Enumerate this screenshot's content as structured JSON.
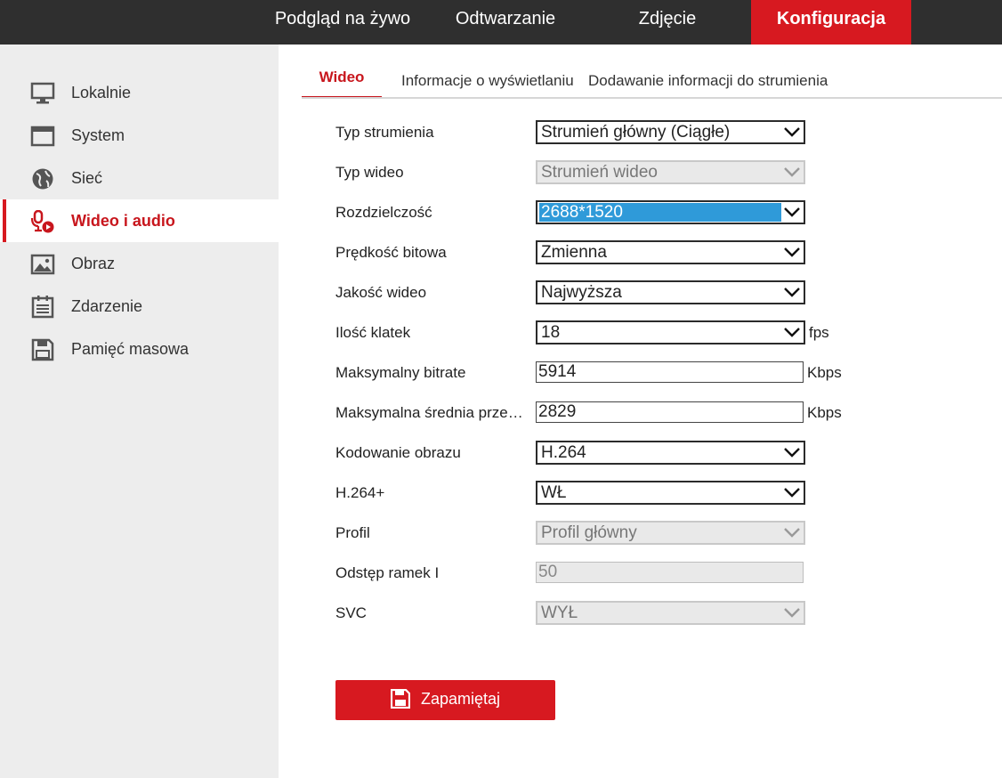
{
  "topnav": {
    "live": "Podgląd na żywo",
    "playback": "Odtwarzanie",
    "picture": "Zdjęcie",
    "config": "Konfiguracja"
  },
  "sidebar": {
    "items": [
      {
        "label": "Lokalnie",
        "icon": "monitor-icon"
      },
      {
        "label": "System",
        "icon": "window-icon"
      },
      {
        "label": "Sieć",
        "icon": "globe-icon"
      },
      {
        "label": "Wideo i audio",
        "icon": "microphone-video-icon",
        "active": true
      },
      {
        "label": "Obraz",
        "icon": "image-icon"
      },
      {
        "label": "Zdarzenie",
        "icon": "calendar-list-icon"
      },
      {
        "label": "Pamięć masowa",
        "icon": "floppy-icon"
      }
    ]
  },
  "tabs": {
    "video": "Wideo",
    "display_info": "Informacje o wyświetlaniu",
    "stream_info": "Dodawanie informacji do strumienia"
  },
  "form": {
    "stream_type": {
      "label": "Typ strumienia",
      "value": "Strumień główny (Ciągłe)"
    },
    "video_type": {
      "label": "Typ wideo",
      "value": "Strumień wideo"
    },
    "resolution": {
      "label": "Rozdzielczość",
      "value": "2688*1520"
    },
    "bitrate_type": {
      "label": "Prędkość bitowa",
      "value": "Zmienna"
    },
    "video_quality": {
      "label": "Jakość wideo",
      "value": "Najwyższa"
    },
    "frame_rate": {
      "label": "Ilość klatek",
      "value": "18",
      "unit": "fps"
    },
    "max_bitrate": {
      "label": "Maksymalny bitrate",
      "value": "5914",
      "unit": "Kbps"
    },
    "avg_bitrate": {
      "label": "Maksymalna średnia prze…",
      "value": "2829",
      "unit": "Kbps"
    },
    "encoding": {
      "label": "Kodowanie obrazu",
      "value": "H.264"
    },
    "h264plus": {
      "label": "H.264+",
      "value": "WŁ"
    },
    "profile": {
      "label": "Profil",
      "value": "Profil główny"
    },
    "i_frame": {
      "label": "Odstęp ramek I",
      "value": "50"
    },
    "svc": {
      "label": "SVC",
      "value": "WYŁ"
    }
  },
  "save_button": {
    "label": "Zapamiętaj",
    "icon": "floppy-icon"
  },
  "colors": {
    "accent": "#d71920",
    "topbar": "#2f2f2f",
    "sidebar": "#ededed",
    "selection": "#2f9ad9"
  }
}
